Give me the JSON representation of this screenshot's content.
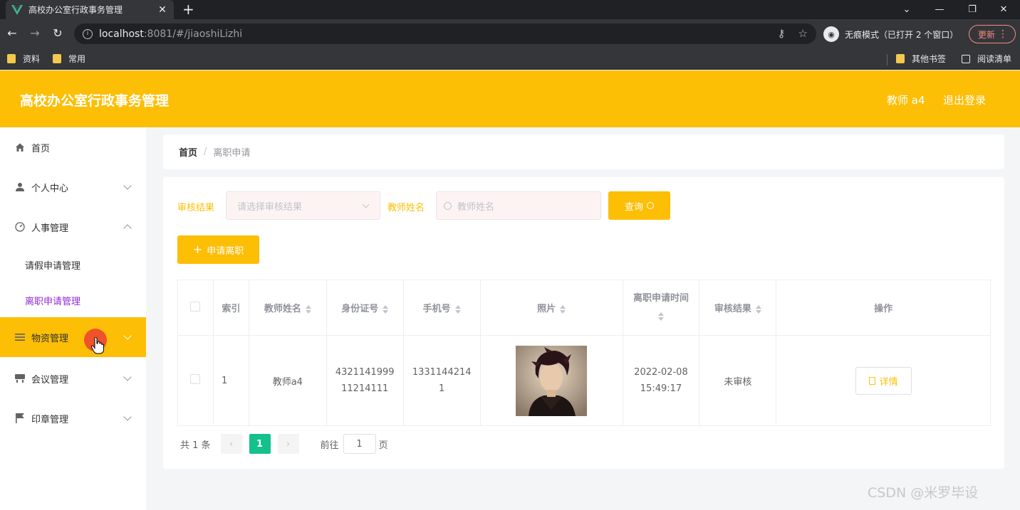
{
  "browser": {
    "tab_title": "高校办公室行政事务管理",
    "url_host": "localhost",
    "url_rest": ":8081/#/jiaoshiLizhi",
    "incognito_label": "无痕模式（已打开 2 个窗口）",
    "update_label": "更新",
    "bookmarks": [
      "资料",
      "常用"
    ],
    "other_bookmarks": "其他书签",
    "reading_list": "阅读清单"
  },
  "header": {
    "title": "高校办公室行政事务管理",
    "user": "教师 a4",
    "logout": "退出登录",
    "accent_color": "#fdbe06"
  },
  "sidebar": {
    "items": [
      {
        "label": "首页",
        "icon": "home-icon"
      },
      {
        "label": "个人中心",
        "icon": "user-icon"
      },
      {
        "label": "人事管理",
        "icon": "gauge-icon"
      },
      {
        "label": "请假申请管理"
      },
      {
        "label": "离职申请管理"
      },
      {
        "label": "物资管理",
        "icon": "list-icon"
      },
      {
        "label": "会议管理",
        "icon": "desk-icon"
      },
      {
        "label": "印章管理",
        "icon": "flag-icon"
      }
    ]
  },
  "breadcrumb": {
    "home": "首页",
    "sep": "/",
    "current": "离职申请"
  },
  "filters": {
    "result_label": "审核结果",
    "result_placeholder": "请选择审核结果",
    "name_label": "教师姓名",
    "name_placeholder": "教师姓名",
    "query_button": "查询",
    "apply_button": "申请离职"
  },
  "table": {
    "headers": [
      "索引",
      "教师姓名",
      "身份证号",
      "手机号",
      "照片",
      "离职申请时间",
      "审核结果",
      "操作"
    ],
    "rows": [
      {
        "index": "1",
        "name": "教师a4",
        "id_line1": "4321141999",
        "id_line2": "11214111",
        "phone_line1": "1331144214",
        "phone_line2": "1",
        "date": "2022-02-08",
        "time": "15:49:17",
        "status": "未审核",
        "action": "详情"
      }
    ]
  },
  "pagination": {
    "total": "共 1 条",
    "current": "1",
    "goto_label": "前往",
    "goto_value": "1",
    "page_label": "页"
  },
  "watermark": "CSDN @米罗毕设"
}
